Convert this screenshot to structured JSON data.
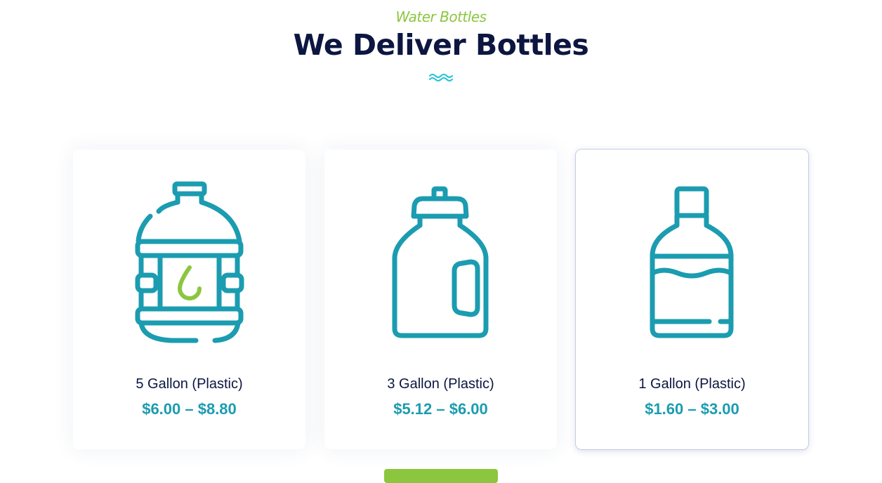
{
  "section": {
    "eyebrow": "Water Bottles",
    "title": "We Deliver Bottles"
  },
  "products": [
    {
      "name": "5 Gallon (Plastic)",
      "price": "$6.00 – $8.80",
      "icon": "five-gallon-jug-icon"
    },
    {
      "name": "3 Gallon (Plastic)",
      "price": "$5.12 – $6.00",
      "icon": "three-gallon-jug-icon"
    },
    {
      "name": "1 Gallon (Plastic)",
      "price": "$1.60 – $3.00",
      "icon": "one-gallon-bottle-icon"
    }
  ],
  "colors": {
    "accent_green": "#8cc63f",
    "teal": "#1b9cb0",
    "navy": "#0c1640",
    "wave": "#22c3d8"
  }
}
